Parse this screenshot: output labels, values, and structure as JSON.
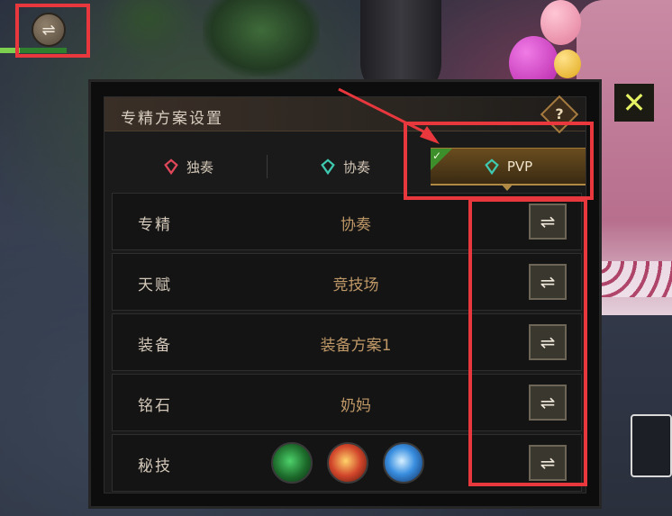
{
  "top_switch": {
    "icon": "swap-arrows-icon",
    "glyph": "⇌"
  },
  "health_bar": {
    "fill_fraction": 0.3
  },
  "close": {
    "glyph": "✕"
  },
  "panel": {
    "title": "专精方案设置",
    "help_glyph": "?",
    "tabs": [
      {
        "label": "独奏",
        "gem_color": "#e0485a"
      },
      {
        "label": "协奏",
        "gem_color": "#3fc9b0"
      },
      {
        "label": "PVP",
        "gem_color": "#3fc9b0",
        "selected": true,
        "check_glyph": "✓"
      }
    ],
    "rows": [
      {
        "label": "专精",
        "value": "协奏",
        "button_glyph": "⇌"
      },
      {
        "label": "天赋",
        "value": "竞技场",
        "button_glyph": "⇌"
      },
      {
        "label": "装备",
        "value": "装备方案1",
        "button_glyph": "⇌"
      },
      {
        "label": "铭石",
        "value": "奶妈",
        "button_glyph": "⇌"
      },
      {
        "label": "秘技",
        "skills": [
          "nature-skill-icon",
          "fire-skill-icon",
          "frost-skill-icon"
        ],
        "button_glyph": "⇌"
      }
    ]
  },
  "colors": {
    "highlight": "#e8383d",
    "value_text": "#bf9867",
    "tab_selected": "#6a4d1f"
  }
}
